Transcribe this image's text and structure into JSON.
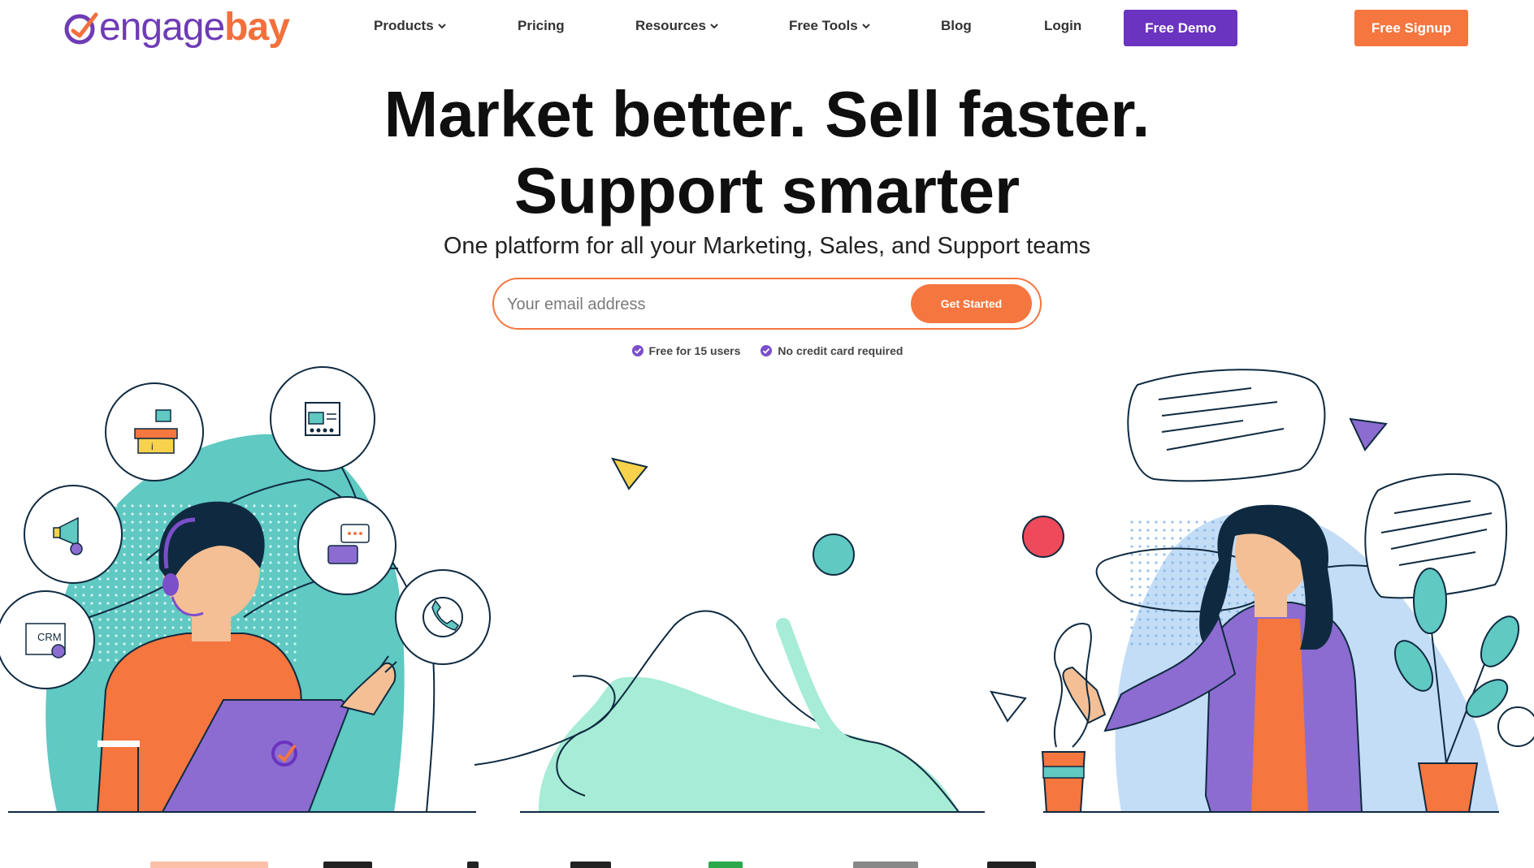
{
  "brand": {
    "name_part1": "engage",
    "name_part2": "bay",
    "colors": {
      "purple": "#6a33c0",
      "orange": "#f5763f",
      "teal": "#5fc9c2",
      "mint": "#a6ecd6",
      "navy": "#0f2a40"
    }
  },
  "nav": {
    "items": [
      {
        "label": "Products",
        "has_dropdown": true
      },
      {
        "label": "Pricing",
        "has_dropdown": false
      },
      {
        "label": "Resources",
        "has_dropdown": true
      },
      {
        "label": "Free Tools",
        "has_dropdown": true
      },
      {
        "label": "Blog",
        "has_dropdown": false
      },
      {
        "label": "Login",
        "has_dropdown": false
      }
    ],
    "demo_button": "Free Demo",
    "signup_button": "Free Signup"
  },
  "hero": {
    "title_line1": "Market better. Sell faster.",
    "title_line2": "Support smarter",
    "subtitle": "One platform for all your Marketing, Sales, and Support teams",
    "email_placeholder": "Your email address",
    "cta_button": "Get Started",
    "perks": [
      "Free for 15 users",
      "No credit card required"
    ]
  },
  "illustration": {
    "icons": [
      "helpdesk-icon",
      "image-gallery-icon",
      "megaphone-icon",
      "chat-icon",
      "crm-icon",
      "phone-icon"
    ],
    "crm_label": "CRM"
  }
}
